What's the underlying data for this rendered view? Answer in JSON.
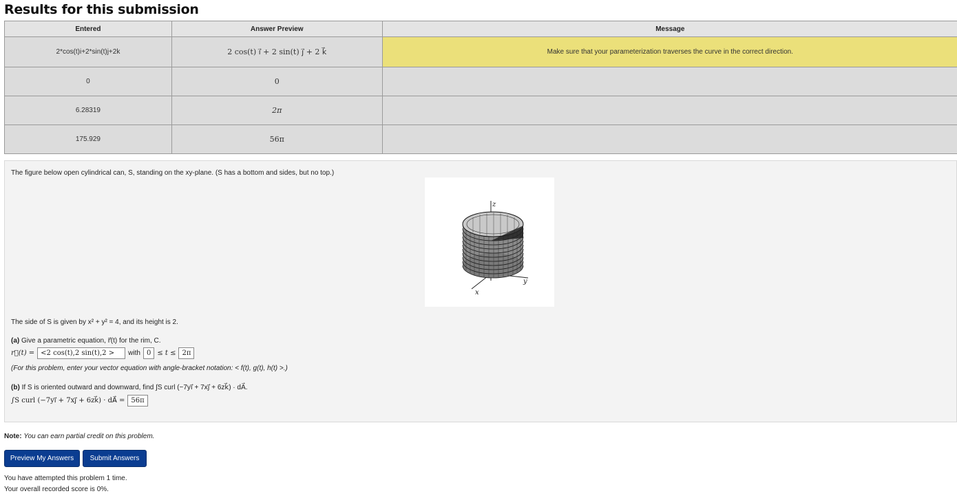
{
  "page": {
    "title": "Results for this submission"
  },
  "results_table": {
    "headers": [
      "Entered",
      "Answer Preview",
      "Message"
    ],
    "rows": [
      {
        "entered": "2*cos(t)i+2*sin(t)j+2k",
        "preview": "2 cos(t) i⃗ + 2 sin(t) j⃗ + 2 k⃗",
        "message": "Make sure that your parameterization traverses the curve in the correct direction.",
        "message_color": "#ebe07a"
      },
      {
        "entered": "0",
        "preview": "0",
        "message": ""
      },
      {
        "entered": "6.28319",
        "preview": "2π",
        "message": ""
      },
      {
        "entered": "175.929",
        "preview": "56π",
        "message": ""
      }
    ]
  },
  "problem": {
    "intro": "The figure below open cylindrical can, S, standing on the xy-plane. (S has a bottom and sides, but no top.)",
    "figure_labels": {
      "z": "z",
      "x": "x",
      "y": "y"
    },
    "side_text": "The side of S is given by x² + y² = 4, and its height is 2.",
    "part_a_label": "(a)",
    "part_a_text": "Give a parametric equation, r⃗(t) for the rim, C.",
    "part_a_lhs": "r⃗(t) =",
    "part_a_answer": "<2 cos(t),2 sin(t),2 >",
    "part_a_with": "with",
    "part_a_lower": "0",
    "part_a_ineq": "≤ t ≤",
    "part_a_upper": "2π",
    "part_a_hint": "(For this problem, enter your vector equation with angle-bracket notation: < f(t), g(t), h(t) >.)",
    "part_b_label": "(b)",
    "part_b_text": "If S is oriented outward and downward, find ∫S curl (−7yi⃗ + 7xj⃗ + 6zk⃗) · dA⃗.",
    "part_b_lhs": "∫S curl (−7yi⃗ + 7xj⃗ + 6zk⃗) · dA⃗ =",
    "part_b_answer": "56π"
  },
  "note": {
    "label": "Note:",
    "text": "You can earn partial credit on this problem."
  },
  "buttons": {
    "preview": "Preview My Answers",
    "submit": "Submit Answers"
  },
  "footer": {
    "attempts": "You have attempted this problem 1 time.",
    "score": "Your overall recorded score is 0%."
  }
}
